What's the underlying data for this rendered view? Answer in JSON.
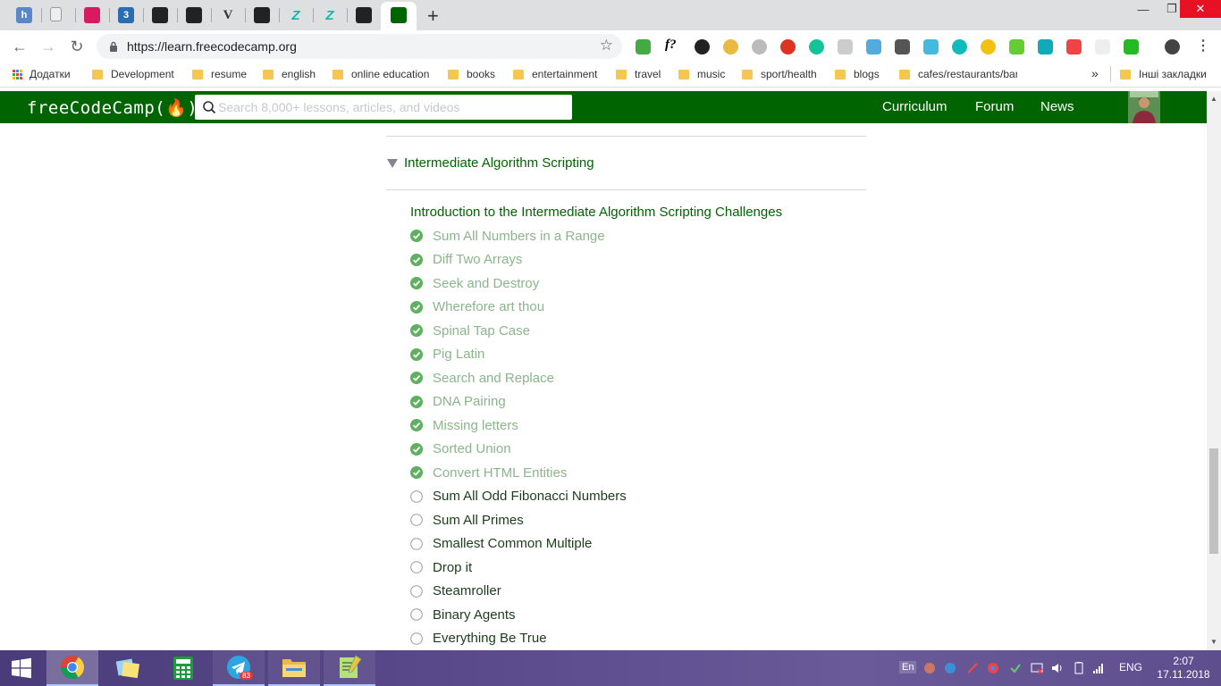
{
  "browser": {
    "tabs": [
      {
        "icon": "h-letter-icon",
        "glyph": "h",
        "color": "#5a87c5"
      },
      {
        "icon": "blank-page-icon",
        "glyph": "",
        "color": "#dedfe1"
      },
      {
        "icon": "pacman-ghost-icon",
        "glyph": "",
        "color": "#d81b60"
      },
      {
        "icon": "css3-icon",
        "glyph": "3",
        "color": "#2a6db3"
      },
      {
        "icon": "tree-icon",
        "glyph": "",
        "color": "#222"
      },
      {
        "icon": "github-icon",
        "glyph": "",
        "color": "#222"
      },
      {
        "icon": "v-letter-icon",
        "glyph": "V",
        "color": "#dedfe1"
      },
      {
        "icon": "github-icon",
        "glyph": "",
        "color": "#222"
      },
      {
        "icon": "z-logo-icon",
        "glyph": "Z",
        "color": "#dedfe1"
      },
      {
        "icon": "z-logo-icon",
        "glyph": "Z",
        "color": "#dedfe1"
      },
      {
        "icon": "bars-icon",
        "glyph": "",
        "color": "#222"
      },
      {
        "icon": "freecodecamp-icon",
        "glyph": "",
        "color": "#006400"
      }
    ],
    "url": "https://learn.freecodecamp.org",
    "bookmarks": {
      "apps_label": "Додатки",
      "folders": [
        "Development",
        "resume",
        "english",
        "online education",
        "books",
        "entertainment",
        "travel",
        "music",
        "sport/health",
        "blogs",
        "cafes/restaurants/bar"
      ],
      "more": "»",
      "other_label": "Інші закладки"
    }
  },
  "fcc": {
    "logo": "freeCodeCamp(🔥)",
    "search_placeholder": "Search 8,000+ lessons, articles, and videos",
    "nav": [
      "Curriculum",
      "Forum",
      "News"
    ]
  },
  "section": {
    "title": "Intermediate Algorithm Scripting",
    "intro": "Introduction to the Intermediate Algorithm Scripting Challenges",
    "challenges": [
      {
        "label": "Sum All Numbers in a Range",
        "done": true
      },
      {
        "label": "Diff Two Arrays",
        "done": true
      },
      {
        "label": "Seek and Destroy",
        "done": true
      },
      {
        "label": "Wherefore art thou",
        "done": true
      },
      {
        "label": "Spinal Tap Case",
        "done": true
      },
      {
        "label": "Pig Latin",
        "done": true
      },
      {
        "label": "Search and Replace",
        "done": true
      },
      {
        "label": "DNA Pairing",
        "done": true
      },
      {
        "label": "Missing letters",
        "done": true
      },
      {
        "label": "Sorted Union",
        "done": true
      },
      {
        "label": "Convert HTML Entities",
        "done": true
      },
      {
        "label": "Sum All Odd Fibonacci Numbers",
        "done": false
      },
      {
        "label": "Sum All Primes",
        "done": false
      },
      {
        "label": "Smallest Common Multiple",
        "done": false
      },
      {
        "label": "Drop it",
        "done": false
      },
      {
        "label": "Steamroller",
        "done": false
      },
      {
        "label": "Binary Agents",
        "done": false
      },
      {
        "label": "Everything Be True",
        "done": false
      }
    ]
  },
  "taskbar": {
    "apps": [
      "windows-start-icon",
      "chrome-icon",
      "sticky-notes-icon",
      "calculator-icon",
      "telegram-icon",
      "file-explorer-icon",
      "notepad-plus-plus-icon"
    ],
    "telegram_badge": "83",
    "tray_input": "En",
    "language": "ENG",
    "time": "2:07",
    "date": "17.11.2018"
  },
  "colors": {
    "fcc_green": "#006400",
    "done_text": "#8bb58b",
    "check_green": "#5fb05f"
  }
}
